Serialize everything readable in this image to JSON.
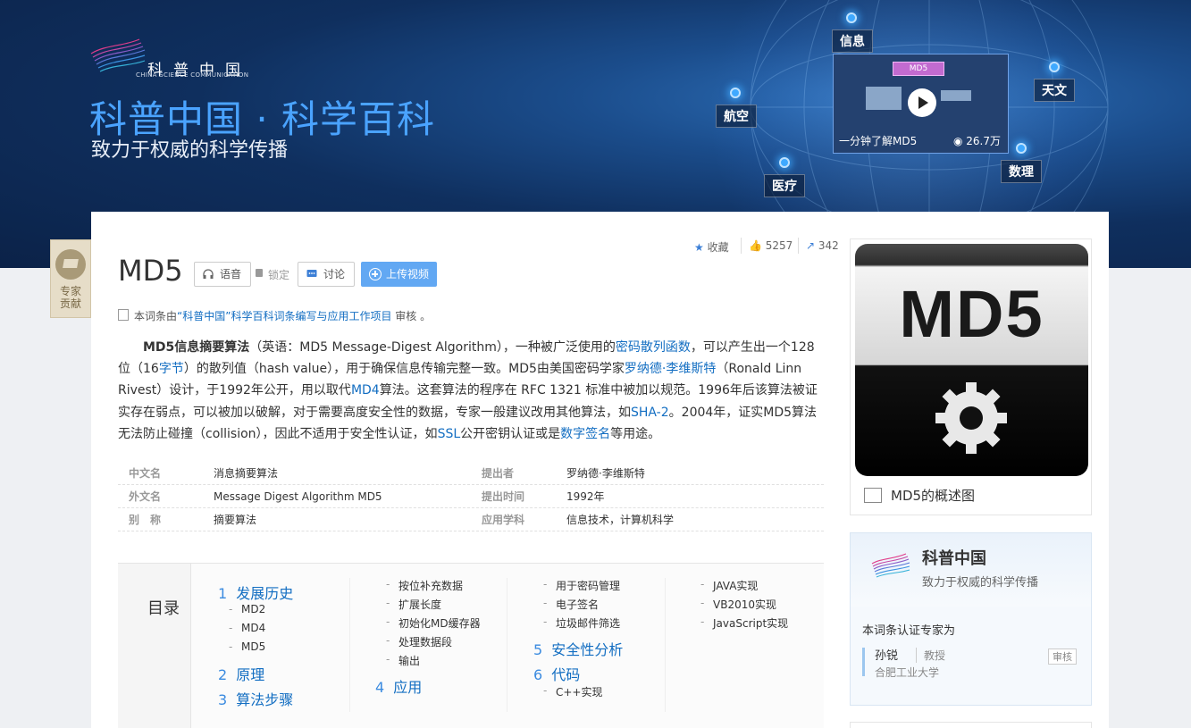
{
  "banner": {
    "logo_cn": "科普中国",
    "logo_en": "CHINA SCIENCE COMMUNICATION",
    "title": "科普中国 · 科学百科",
    "subtitle": "致力于权威的科学传播",
    "tags": [
      "信息",
      "天文",
      "航空",
      "数理",
      "医疗"
    ],
    "video": {
      "title": "一分钟了解MD5",
      "views": "26.7万",
      "slide_label": "MD5"
    }
  },
  "side_badge": {
    "line1": "专家",
    "line2": "贡献"
  },
  "entry": {
    "title": "MD5",
    "buttons": {
      "voice": "语音",
      "lock": "锁定",
      "discuss": "讨论",
      "upload": "上传视频"
    },
    "stats": {
      "favorite": "收藏",
      "likes": "5257",
      "shares": "342"
    },
    "review": {
      "prefix": "本词条由",
      "link": "“科普中国”科学百科词条编写与应用工作项目",
      "suffix": " 审核 。"
    }
  },
  "summary": {
    "bold": "MD5信息摘要算法",
    "t1": "（英语：MD5 Message-Digest Algorithm），一种被广泛使用的",
    "l1": "密码散列函数",
    "t2": "，可以产生出一个128位（16",
    "l2": "字节",
    "t3": "）的散列值（hash value），用于确保信息传输完整一致。MD5由美国密码学家",
    "l3": "罗纳德·李维斯特",
    "t4": "（Ronald Linn Rivest）设计，于1992年公开，用以取代",
    "l4": "MD4",
    "t5": "算法。这套算法的程序在 RFC 1321 标准中被加以规范。1996年后该算法被证实存在弱点，可以被加以破解，对于需要高度安全性的数据，专家一般建议改用其他算法，如",
    "l5": "SHA-2",
    "t6": "。2004年，证实MD5算法无法防止碰撞（collision），因此不适用于安全性认证，如",
    "l6": "SSL",
    "t7": "公开密钥认证或是",
    "l7": "数字签名",
    "t8": "等用途。"
  },
  "info": {
    "rows": [
      {
        "k1": "中文名",
        "v1": "消息摘要算法",
        "k2": "提出者",
        "v2": "罗纳德·李维斯特"
      },
      {
        "k1": "外文名",
        "v1": "Message Digest Algorithm MD5",
        "k2": "提出时间",
        "v2": "1992年"
      },
      {
        "k1": "别　称",
        "v1": "摘要算法",
        "k2": "应用学科",
        "v2": "信息技术，计算机科学"
      }
    ]
  },
  "toc": {
    "label": "目录",
    "s1": {
      "n": "1",
      "t": "发展历史"
    },
    "s1_items": [
      "MD2",
      "MD4",
      "MD5"
    ],
    "s2": {
      "n": "2",
      "t": "原理"
    },
    "s3": {
      "n": "3",
      "t": "算法步骤"
    },
    "s3_items": [
      "按位补充数据",
      "扩展长度",
      "初始化MD缓存器",
      "处理数据段",
      "输出"
    ],
    "s4": {
      "n": "4",
      "t": "应用"
    },
    "s4_items": [
      "用于密码管理",
      "电子签名",
      "垃圾邮件筛选"
    ],
    "s5": {
      "n": "5",
      "t": "安全性分析"
    },
    "s6": {
      "n": "6",
      "t": "代码"
    },
    "s6_items": [
      "C++实现",
      "JAVA实现",
      "VB2010实现",
      "JavaScript实现"
    ]
  },
  "image": {
    "text": "MD5",
    "caption": "MD5的概述图"
  },
  "expert": {
    "org": "科普中国",
    "org_sub": "致力于权威的科学传播",
    "cert": "本词条认证专家为",
    "name": "孙锐",
    "title": "教授",
    "school": "合肥工业大学",
    "audit": "审核"
  }
}
